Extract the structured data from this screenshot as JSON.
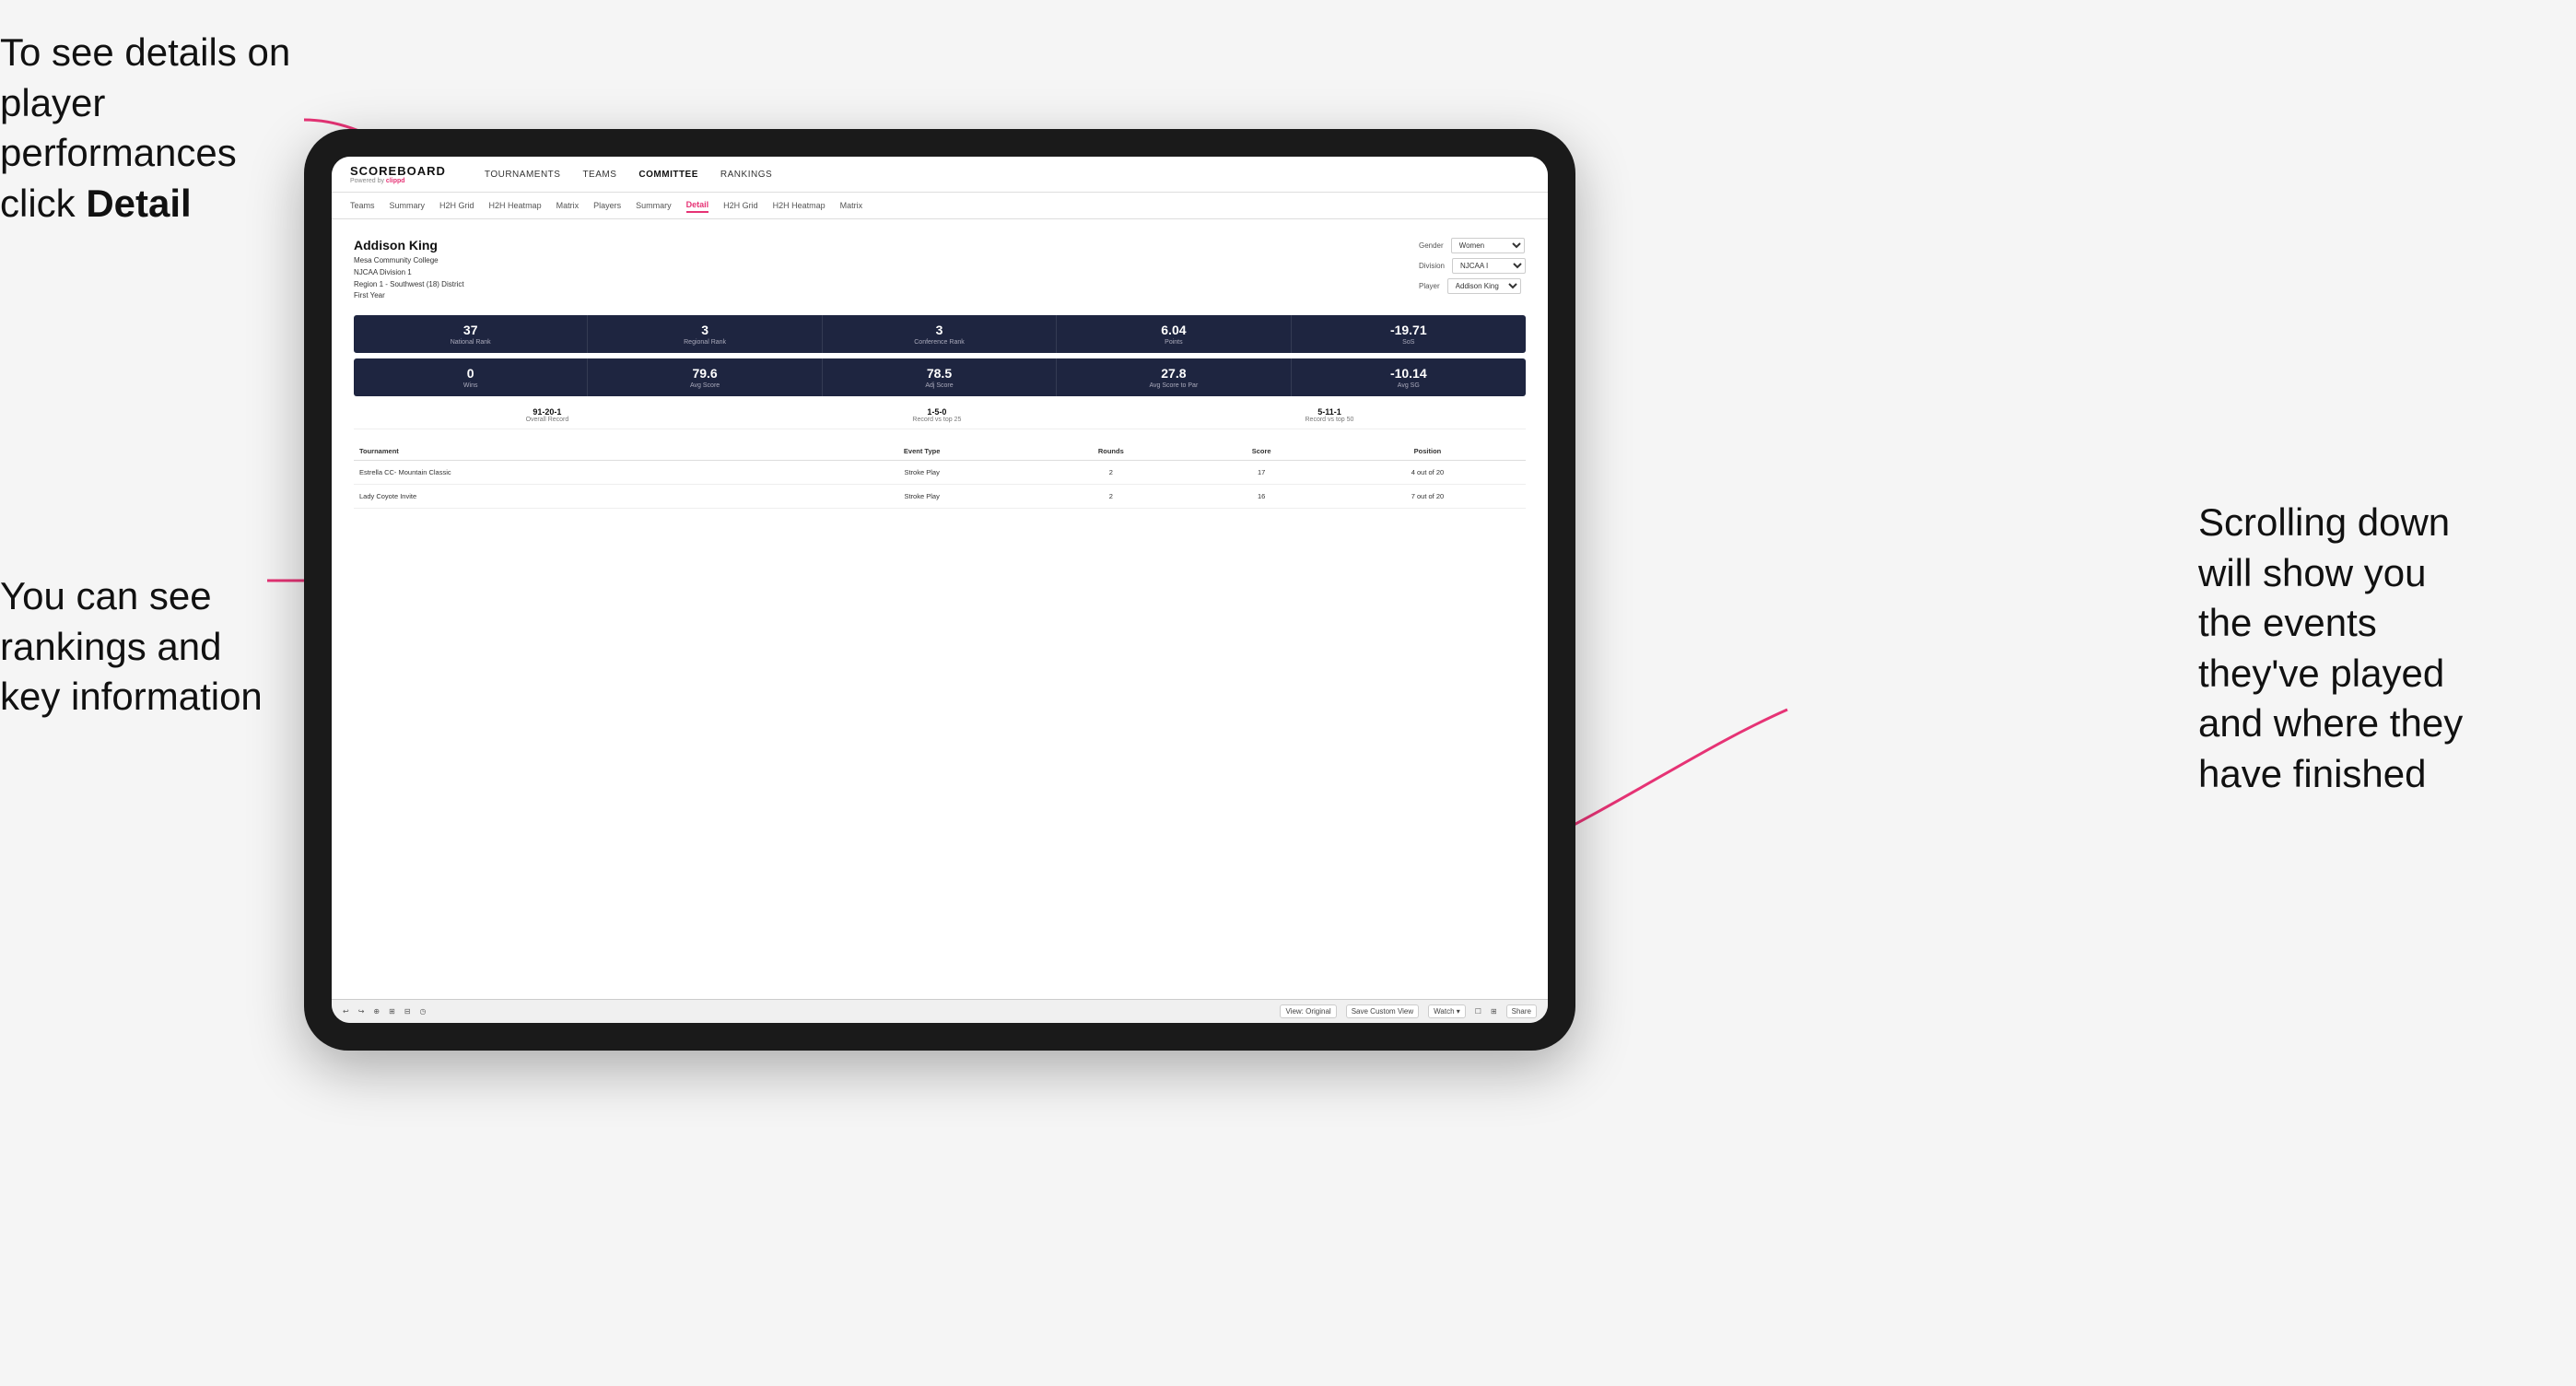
{
  "annotations": {
    "top_left": {
      "line1": "To see details on",
      "line2": "player performances",
      "line3": "click ",
      "line3_bold": "Detail"
    },
    "middle_left": {
      "line1": "You can see",
      "line2": "rankings and",
      "line3": "key information"
    },
    "right": {
      "line1": "Scrolling down",
      "line2": "will show you",
      "line3": "the events",
      "line4": "they've played",
      "line5": "and where they",
      "line6": "have finished"
    }
  },
  "app": {
    "logo": "SCOREBOARD",
    "powered_by": "Powered by clippd",
    "nav": {
      "items": [
        "TOURNAMENTS",
        "TEAMS",
        "COMMITTEE",
        "RANKINGS"
      ]
    },
    "sub_nav": {
      "items": [
        "Teams",
        "Summary",
        "H2H Grid",
        "H2H Heatmap",
        "Matrix",
        "Players",
        "Summary",
        "Detail",
        "H2H Grid",
        "H2H Heatmap",
        "Matrix"
      ],
      "active": "Detail"
    }
  },
  "player": {
    "name": "Addison King",
    "college": "Mesa Community College",
    "division": "NJCAA Division 1",
    "region": "Region 1 - Southwest (18) District",
    "year": "First Year",
    "filters": {
      "gender_label": "Gender",
      "gender_value": "Women",
      "division_label": "Division",
      "division_value": "NJCAA I",
      "player_label": "Player",
      "player_value": "Addison King"
    }
  },
  "stats_row1": [
    {
      "value": "37",
      "label": "National Rank"
    },
    {
      "value": "3",
      "label": "Regional Rank"
    },
    {
      "value": "3",
      "label": "Conference Rank"
    },
    {
      "value": "6.04",
      "label": "Points"
    },
    {
      "value": "-19.71",
      "label": "SoS"
    }
  ],
  "stats_row2": [
    {
      "value": "0",
      "label": "Wins"
    },
    {
      "value": "79.6",
      "label": "Avg Score"
    },
    {
      "value": "78.5",
      "label": "Adj Score"
    },
    {
      "value": "27.8",
      "label": "Avg Score to Par"
    },
    {
      "value": "-10.14",
      "label": "Avg SG"
    }
  ],
  "records": [
    {
      "value": "91-20-1",
      "label": "Overall Record"
    },
    {
      "value": "1-5-0",
      "label": "Record vs top 25"
    },
    {
      "value": "5-11-1",
      "label": "Record vs top 50"
    }
  ],
  "table": {
    "headers": [
      "Tournament",
      "Event Type",
      "Rounds",
      "Score",
      "Position"
    ],
    "rows": [
      {
        "tournament": "Estrella CC- Mountain Classic",
        "event_type": "Stroke Play",
        "rounds": "2",
        "score": "17",
        "position": "4 out of 20"
      },
      {
        "tournament": "Lady Coyote Invite",
        "event_type": "Stroke Play",
        "rounds": "2",
        "score": "16",
        "position": "7 out of 20"
      }
    ]
  },
  "toolbar": {
    "undo": "↩",
    "redo": "↪",
    "view_original": "View: Original",
    "save_custom": "Save Custom View",
    "watch": "Watch ▾",
    "share": "Share"
  }
}
